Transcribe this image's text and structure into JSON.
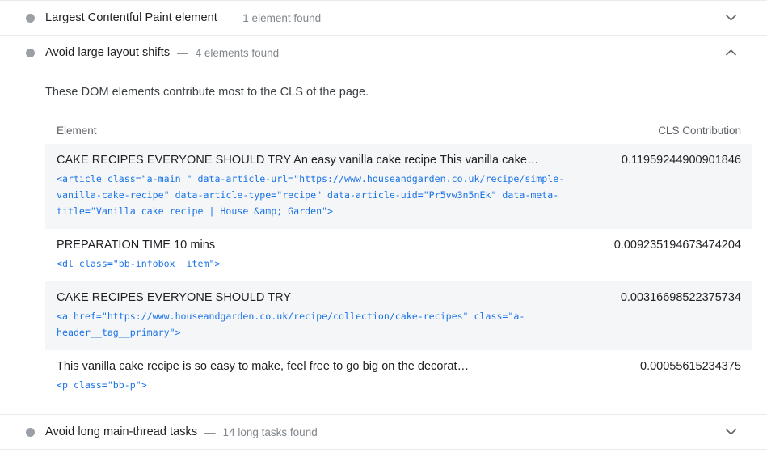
{
  "audits": [
    {
      "id": "largest-contentful-paint-element",
      "title": "Largest Contentful Paint element",
      "dash": "—",
      "subtitle": "1 element found",
      "expanded": false,
      "chevron": "chevron-down-icon"
    },
    {
      "id": "avoid-large-layout-shifts",
      "title": "Avoid large layout shifts",
      "dash": "—",
      "subtitle": "4 elements found",
      "expanded": true,
      "chevron": "chevron-up-icon",
      "description": "These DOM elements contribute most to the CLS of the page.",
      "table": {
        "columns": {
          "element": "Element",
          "value": "CLS Contribution"
        },
        "rows": [
          {
            "text": "CAKE RECIPES EVERYONE SHOULD TRY An easy vanilla cake recipe This vanilla cake…",
            "snippet": "<article class=\"a-main \" data-article-url=\"https://www.houseandgarden.co.uk/recipe/simple-vanilla-cake-recipe\" data-article-type=\"recipe\" data-article-uid=\"Pr5vw3n5nEk\" data-meta-title=\"Vanilla cake recipe | House &amp; Garden\">",
            "value": "0.11959244900901846",
            "striped": true
          },
          {
            "text": "PREPARATION TIME 10 mins",
            "snippet": "<dl class=\"bb-infobox__item\">",
            "value": "0.009235194673474204",
            "striped": false
          },
          {
            "text": "CAKE RECIPES EVERYONE SHOULD TRY",
            "snippet": "<a href=\"https://www.houseandgarden.co.uk/recipe/collection/cake-recipes\" class=\"a-header__tag__primary\">",
            "value": "0.00316698522375734",
            "striped": true
          },
          {
            "text": "This vanilla cake recipe is so easy to make, feel free to go big on the decorat…",
            "snippet": "<p class=\"bb-p\">",
            "value": "0.00055615234375",
            "striped": false
          }
        ]
      }
    },
    {
      "id": "avoid-long-main-thread-tasks",
      "title": "Avoid long main-thread tasks",
      "dash": "—",
      "subtitle": "14 long tasks found",
      "expanded": false,
      "chevron": "chevron-down-icon"
    }
  ],
  "colors": {
    "bullet": "#9aa0a6",
    "snippet": "#1a73e8",
    "stripe": "#f5f6f7",
    "divider": "#e8eaed",
    "text": "#202124",
    "muted": "#80868b"
  }
}
